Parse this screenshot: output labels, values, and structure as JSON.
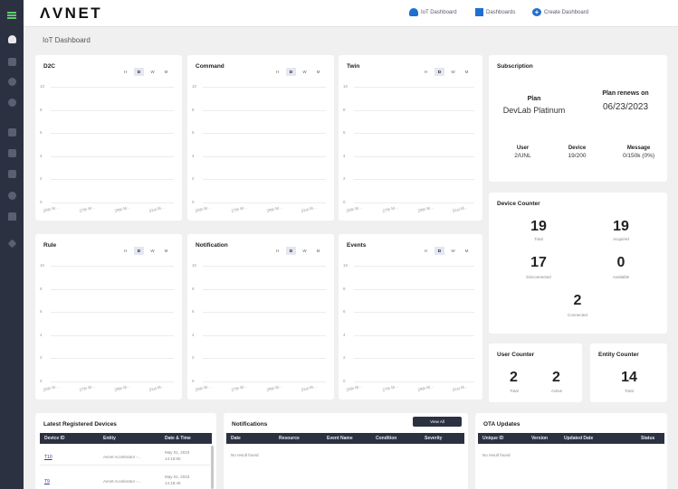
{
  "topbar": {
    "logo": "ΛVNET",
    "links": [
      {
        "label": "IoT Dashboard",
        "icon": "cloud-icon"
      },
      {
        "label": "Dashboards",
        "icon": "dashboard-icon"
      },
      {
        "label": "Create Dashboard",
        "icon": "plus-circle-icon"
      }
    ]
  },
  "page": {
    "title": "IoT Dashboard"
  },
  "range_options": [
    "H",
    "D",
    "W",
    "M"
  ],
  "range_selected": "D",
  "y_ticks": [
    "10",
    "8",
    "6",
    "4",
    "2",
    "0"
  ],
  "x_ticks": [
    "25th M...",
    "27th M...",
    "29th M...",
    "31st M..."
  ],
  "charts": [
    {
      "title": "D2C"
    },
    {
      "title": "Command"
    },
    {
      "title": "Twin"
    },
    {
      "title": "Rule"
    },
    {
      "title": "Notification"
    },
    {
      "title": "Events"
    }
  ],
  "subscription": {
    "title": "Subscription",
    "plan_label": "Plan",
    "plan_value": "DevLab Platinum",
    "renew_label": "Plan renews on",
    "renew_value": "06/23/2023",
    "user_label": "User",
    "user_value": "2/UNL",
    "device_label": "Device",
    "device_value": "19/200",
    "message_label": "Message",
    "message_value": "0/150k (0%)"
  },
  "device_counter": {
    "title": "Device Counter",
    "total": "19",
    "total_label": "Total",
    "acquired": "19",
    "acquired_label": "Acquired",
    "disconnected": "17",
    "disconnected_label": "Disconnected",
    "available": "0",
    "available_label": "Available",
    "connected": "2",
    "connected_label": "Connected"
  },
  "user_counter": {
    "title": "User Counter",
    "total": "2",
    "total_label": "Total",
    "active": "2",
    "active_label": "Active"
  },
  "entity_counter": {
    "title": "Entity Counter",
    "total": "14",
    "total_label": "Total"
  },
  "latest_devices": {
    "title": "Latest Registered Devices",
    "columns": [
      "Device ID",
      "Entity",
      "Date & Time"
    ],
    "rows": [
      {
        "id": "T10",
        "entity": "Avnet Accelerator -...",
        "date": "May 01, 2023",
        "time": "14:18:55"
      },
      {
        "id": "T9",
        "entity": "Avnet Accelerator -...",
        "date": "May 01, 2023",
        "time": "14:18:45"
      }
    ]
  },
  "notifications": {
    "title": "Notifications",
    "view_all": "View All",
    "columns": [
      "Date",
      "Resource",
      "Event Name",
      "Condition",
      "Severity"
    ],
    "empty": "No result found"
  },
  "ota": {
    "title": "OTA Updates",
    "columns": [
      "Unique ID",
      "Version",
      "Updated Date",
      "Status"
    ],
    "empty": "No result found"
  }
}
